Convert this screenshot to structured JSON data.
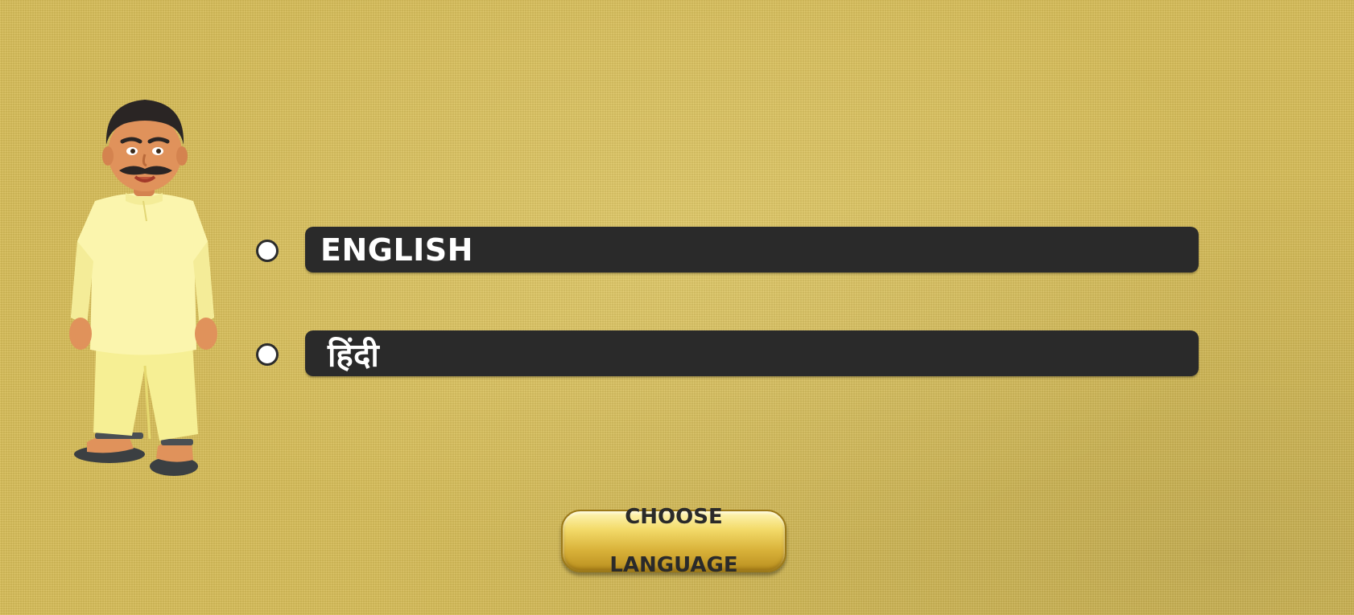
{
  "languages": [
    {
      "id": "english",
      "label": "ENGLISH",
      "selected": false
    },
    {
      "id": "hindi",
      "label": "हिंदी",
      "selected": false
    }
  ],
  "choose_button": {
    "label_line1": "CHOOSE",
    "label_line2": "LANGUAGE"
  },
  "colors": {
    "background": "#d9bf5a",
    "bar": "#2a2a2a",
    "bar_text": "#ffffff",
    "button_gold": "#e6c350"
  },
  "icons": {
    "character": "villager-character-illustration",
    "radio": "radio-circle"
  }
}
